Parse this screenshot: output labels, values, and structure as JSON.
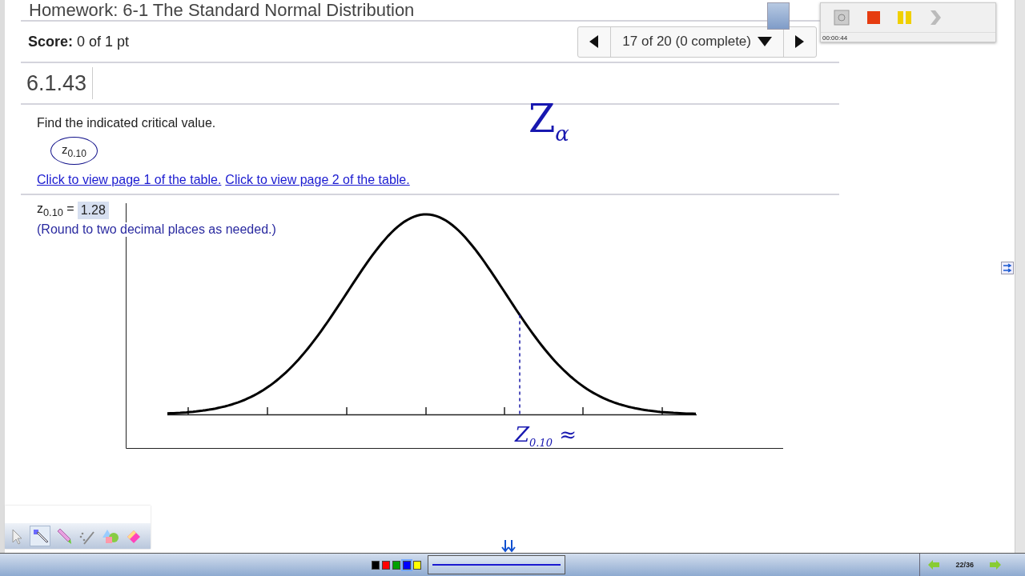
{
  "title": "Homework: 6-1 The Standard Normal Distribution",
  "score": "**Score:** 0 of 1 pt",
  "navigator": {
    "position": "17 of 20 (0 complete)"
  },
  "question_id": "6.1.43",
  "prompt": "Find the indicated critical value.",
  "expression": "z$_{0.10}$",
  "links": [
    "Click to view page 1 of the table.",
    "Click to view page 2 of the table."
  ],
  "answer": {
    "label": "z$_{0.10}$ =",
    "value": "1.28",
    "hint": "(Round to two decimal places as needed.)"
  },
  "ink_annotations": [
    {
      "kind": "note",
      "text": "Z$_{α}$"
    },
    {
      "kind": "label",
      "text": "Z$_{0.10}$ ≈"
    }
  ],
  "recorder": {
    "time": "00:00:44"
  },
  "pen_tools": [
    {
      "kind": "pointer",
      "selected": false
    },
    {
      "kind": "pen",
      "selected": true
    },
    {
      "kind": "highlighter",
      "selected": false
    },
    {
      "kind": "laser",
      "selected": false
    },
    {
      "kind": "shapes",
      "selected": false
    },
    {
      "kind": "eraser",
      "selected": false
    }
  ],
  "colors": [
    {
      "color": "#000000",
      "selected": false
    },
    {
      "color": "#ff0000",
      "selected": false
    },
    {
      "color": "#00a000",
      "selected": false
    },
    {
      "color": "#0000ff",
      "selected": true
    },
    {
      "color": "#ffff00",
      "selected": false
    }
  ],
  "page_counter": "22/36"
}
